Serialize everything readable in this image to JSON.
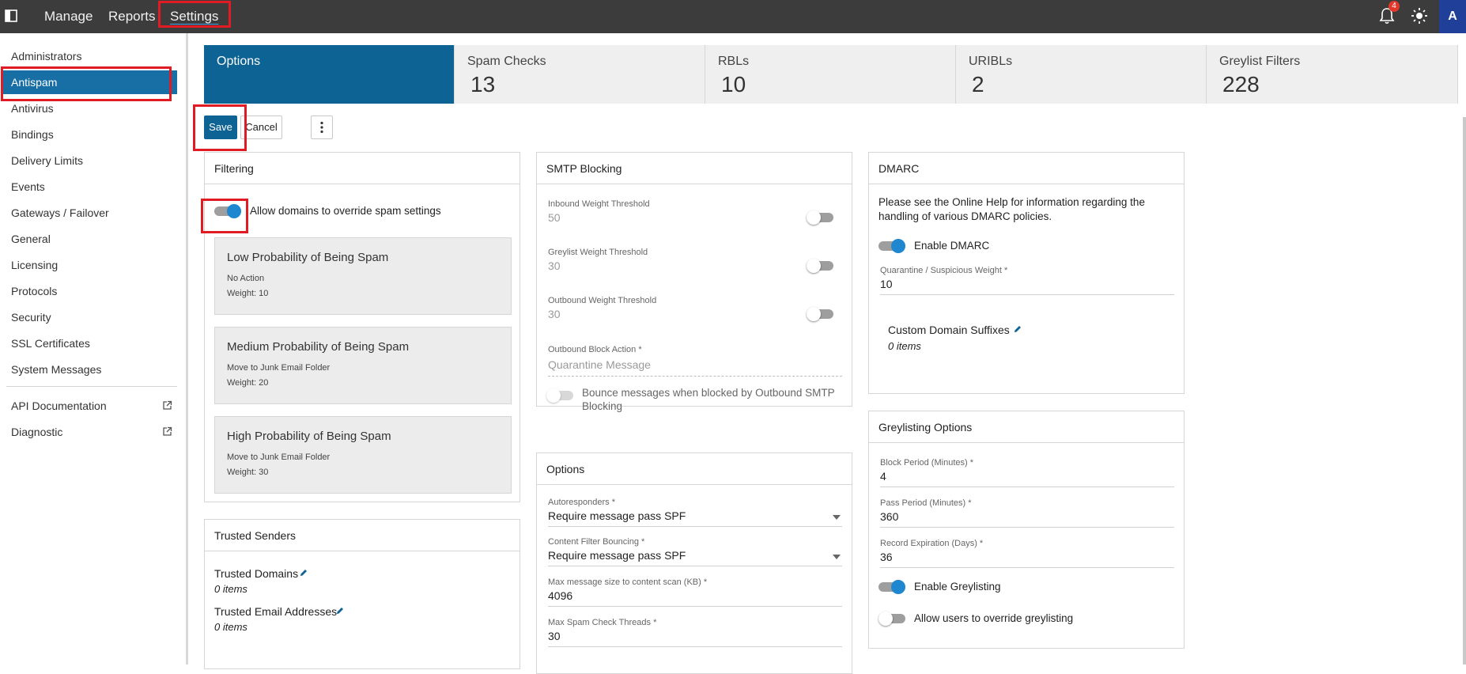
{
  "topnav": {
    "items": [
      {
        "label": "Manage"
      },
      {
        "label": "Reports"
      },
      {
        "label": "Settings"
      }
    ],
    "notification_count": "4",
    "avatar_letter": "A"
  },
  "sidebar": {
    "items": [
      {
        "label": "Administrators"
      },
      {
        "label": "Antispam"
      },
      {
        "label": "Antivirus"
      },
      {
        "label": "Bindings"
      },
      {
        "label": "Delivery Limits"
      },
      {
        "label": "Events"
      },
      {
        "label": "Gateways / Failover"
      },
      {
        "label": "General"
      },
      {
        "label": "Licensing"
      },
      {
        "label": "Protocols"
      },
      {
        "label": "Security"
      },
      {
        "label": "SSL Certificates"
      },
      {
        "label": "System Messages"
      }
    ],
    "external_links": [
      {
        "label": "API Documentation",
        "icon": "external-link-icon"
      },
      {
        "label": "Diagnostic",
        "icon": "external-link-icon"
      }
    ]
  },
  "stat_tabs": [
    {
      "label": "Options",
      "value": ""
    },
    {
      "label": "Spam Checks",
      "value": "13"
    },
    {
      "label": "RBLs",
      "value": "10"
    },
    {
      "label": "URIBLs",
      "value": "2"
    },
    {
      "label": "Greylist Filters",
      "value": "228"
    }
  ],
  "toolbar": {
    "save_label": "Save",
    "cancel_label": "Cancel",
    "more_icon": "vertical-ellipsis-icon"
  },
  "filtering": {
    "title": "Filtering",
    "allow_override_label": "Allow domains to override spam settings",
    "allow_override_on": true,
    "levels": [
      {
        "title": "Low Probability of Being Spam",
        "action": "No Action",
        "weight": "Weight: 10"
      },
      {
        "title": "Medium Probability of Being Spam",
        "action": "Move to Junk Email Folder",
        "weight": "Weight: 20"
      },
      {
        "title": "High Probability of Being Spam",
        "action": "Move to Junk Email Folder",
        "weight": "Weight: 30"
      }
    ]
  },
  "trusted_senders": {
    "title": "Trusted Senders",
    "domains_label": "Trusted Domains",
    "domains_count": "0 items",
    "emails_label": "Trusted Email Addresses",
    "emails_count": "0 items"
  },
  "smtp_blocking": {
    "title": "SMTP Blocking",
    "inbound_label": "Inbound Weight Threshold",
    "inbound_value": "50",
    "greylist_label": "Greylist Weight Threshold",
    "greylist_value": "30",
    "outbound_label": "Outbound Weight Threshold",
    "outbound_value": "30",
    "block_action_label": "Outbound Block Action *",
    "block_action_value": "Quarantine Message",
    "bounce_label_1": "Bounce messages when blocked by Outbound SMTP",
    "bounce_label_2": "Blocking"
  },
  "options": {
    "title": "Options",
    "autoresponders_label": "Autoresponders *",
    "autoresponders_value": "Require message pass SPF",
    "content_filter_label": "Content Filter Bouncing *",
    "content_filter_value": "Require message pass SPF",
    "max_size_label": "Max message size to content scan (KB) *",
    "max_size_value": "4096",
    "max_threads_label": "Max Spam Check Threads *",
    "max_threads_value": "30"
  },
  "dmarc": {
    "title": "DMARC",
    "help_line_1": "Please see the Online Help for information regarding the",
    "help_line_2": "handling of various DMARC policies.",
    "enable_label": "Enable DMARC",
    "enable_on": true,
    "weight_label": "Quarantine / Suspicious Weight *",
    "weight_value": "10",
    "suffixes_label": "Custom Domain Suffixes",
    "suffixes_count": "0 items"
  },
  "greylisting": {
    "title": "Greylisting Options",
    "block_label": "Block Period (Minutes) *",
    "block_value": "4",
    "pass_label": "Pass Period (Minutes) *",
    "pass_value": "360",
    "expiration_label": "Record Expiration (Days) *",
    "expiration_value": "36",
    "enable_label": "Enable Greylisting",
    "enable_on": true,
    "allow_override_label": "Allow users to override greylisting",
    "allow_override_on": false
  },
  "colors": {
    "accent": "#0d6394",
    "sidebar_active": "#186fa5",
    "topbar": "#3c3c3c",
    "highlight_box": "#e01b24",
    "toggle_on": "#1f86d0"
  }
}
